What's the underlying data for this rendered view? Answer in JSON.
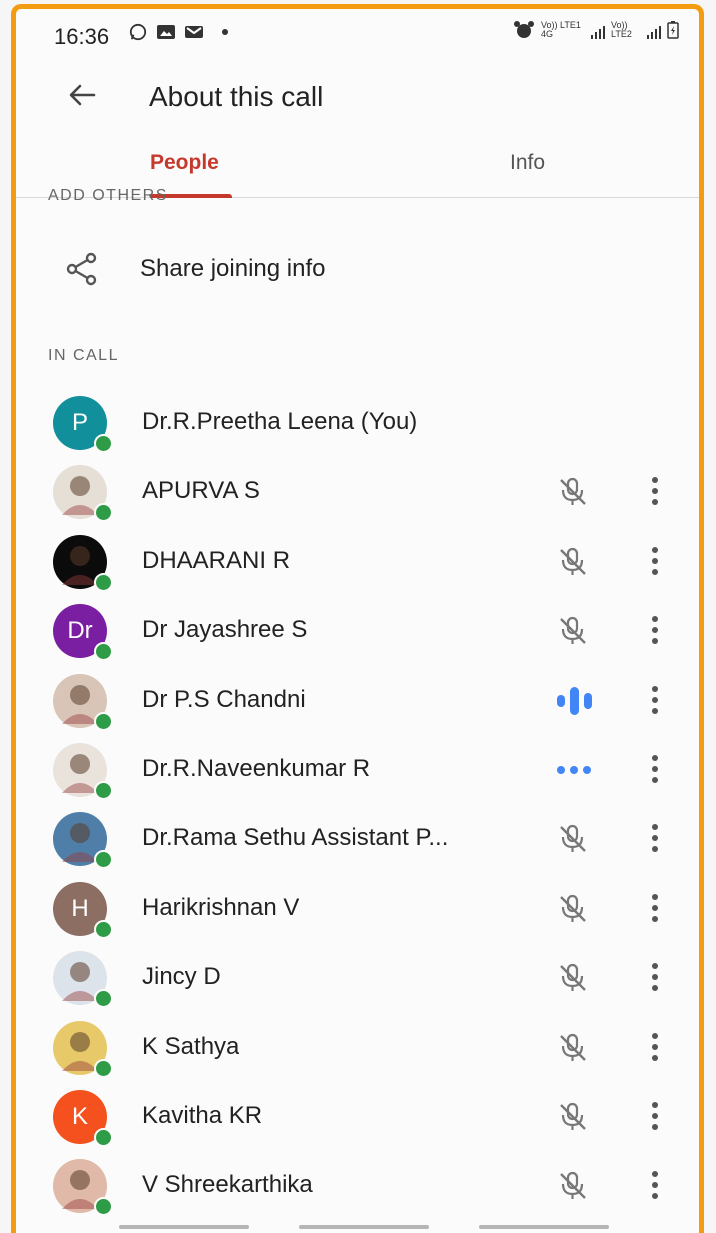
{
  "status_bar": {
    "time": "16:36",
    "network": "Vo)) LTE1 4G",
    "network2": "Vo)) LTE2"
  },
  "header": {
    "title": "About this call"
  },
  "tabs": [
    {
      "label": "People",
      "selected": true
    },
    {
      "label": "Info",
      "selected": false
    }
  ],
  "sections": {
    "add_others": "ADD OTHERS",
    "share_label": "Share joining info",
    "in_call": "IN CALL"
  },
  "colors": {
    "accent": "#c5392c",
    "online": "#2e9b46",
    "speaking": "#4285f4",
    "frame": "#f39c12"
  },
  "participants": [
    {
      "name": "Dr.R.Preetha Leena (You)",
      "avatar_letter": "P",
      "avatar_color": "#118f9a",
      "status": "none"
    },
    {
      "name": "APURVA S",
      "avatar_letter": "",
      "avatar_color": "#e6dfd6",
      "status": "muted"
    },
    {
      "name": "DHAARANI R",
      "avatar_letter": "",
      "avatar_color": "#0b0b0b",
      "status": "muted"
    },
    {
      "name": "Dr Jayashree S",
      "avatar_letter": "Dr",
      "avatar_color": "#7b1fa2",
      "status": "muted"
    },
    {
      "name": "Dr P.S Chandni",
      "avatar_letter": "",
      "avatar_color": "#d9c5b8",
      "status": "speaking"
    },
    {
      "name": "Dr.R.Naveenkumar R",
      "avatar_letter": "",
      "avatar_color": "#e9e3dc",
      "status": "connecting"
    },
    {
      "name": "Dr.Rama Sethu Assistant P...",
      "avatar_letter": "",
      "avatar_color": "#4f7fa8",
      "status": "muted"
    },
    {
      "name": "Harikrishnan V",
      "avatar_letter": "H",
      "avatar_color": "#8d6e63",
      "status": "muted"
    },
    {
      "name": "Jincy D",
      "avatar_letter": "",
      "avatar_color": "#dde3ea",
      "status": "muted"
    },
    {
      "name": "K Sathya",
      "avatar_letter": "",
      "avatar_color": "#e8c96a",
      "status": "muted"
    },
    {
      "name": "Kavitha KR",
      "avatar_letter": "K",
      "avatar_color": "#f4511e",
      "status": "muted"
    },
    {
      "name": "V Shreekarthika",
      "avatar_letter": "",
      "avatar_color": "#e0b9a8",
      "status": "muted"
    }
  ]
}
